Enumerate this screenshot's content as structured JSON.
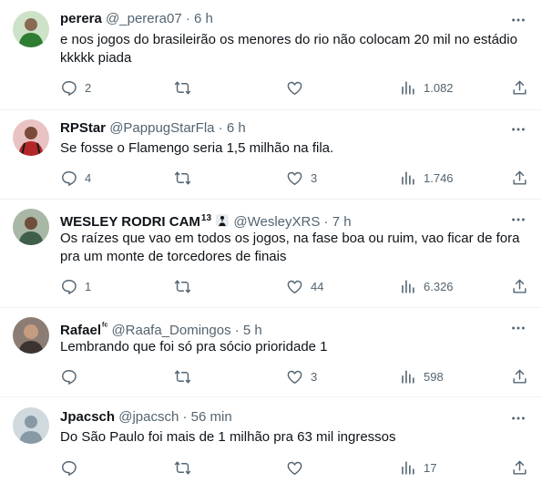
{
  "tweets": [
    {
      "name": "perera",
      "badge": "",
      "handle": "@_perera07",
      "time": "6 h",
      "text": "e nos jogos do brasileirão os menores do rio não colocam 20 mil no estádio kkkkk piada",
      "replies": "2",
      "retweets": "",
      "likes": "",
      "views": "1.082",
      "avatar_color": "#2e7d32"
    },
    {
      "name": "RPStar",
      "badge": "",
      "handle": "@PappugStarFla",
      "time": "6 h",
      "text": "Se fosse o Flamengo seria 1,5 milhão na fila.",
      "replies": "4",
      "retweets": "",
      "likes": "3",
      "views": "1.746",
      "avatar_color": "#b3262a"
    },
    {
      "name": "WESLEY RODRI CAM",
      "badge": "13",
      "handle": "@WesleyXRS",
      "time": "7 h",
      "text": "Os raízes que vao em todos os jogos, na fase boa ou ruim, vao ficar de fora pra um monte de torcedores de finais",
      "replies": "1",
      "retweets": "",
      "likes": "44",
      "views": "6.326",
      "avatar_color": "#3f5f4a"
    },
    {
      "name": "Rafael",
      "badge": "ᶠᶜ",
      "handle": "@Raafa_Domingos",
      "time": "5 h",
      "text": "Lembrando que  foi só pra sócio prioridade 1",
      "replies": "",
      "retweets": "",
      "likes": "3",
      "views": "598",
      "avatar_color": "#6b5a4e"
    },
    {
      "name": "Jpacsch",
      "badge": "",
      "handle": "@jpacsch",
      "time": "56 min",
      "text": "Do São Paulo foi mais de 1 milhão pra 63 mil ingressos",
      "replies": "",
      "retweets": "",
      "likes": "",
      "views": "17",
      "avatar_color": "#cfd9de"
    }
  ],
  "separator": "·"
}
